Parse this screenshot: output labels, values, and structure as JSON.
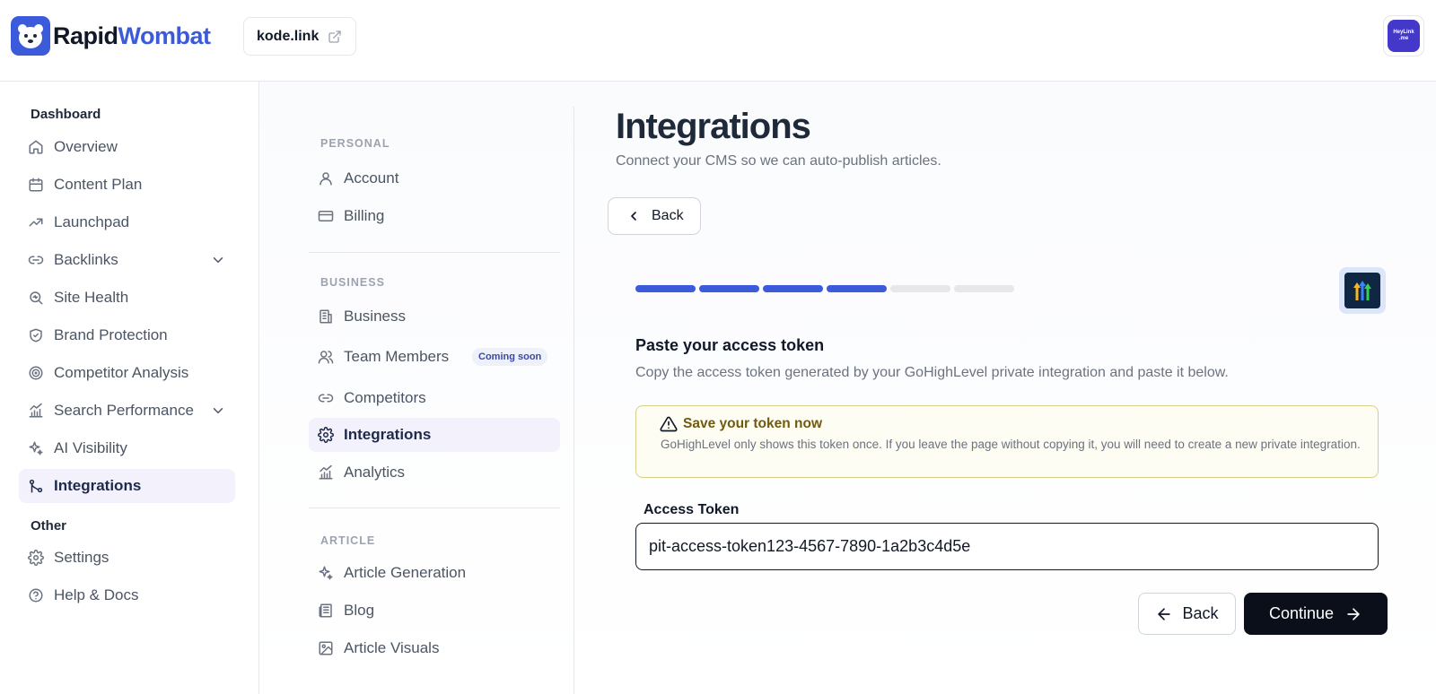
{
  "brand": {
    "name_part1": "Rapid",
    "name_part2": "Wombat",
    "color": "#3b5bdb"
  },
  "site_chip": {
    "label": "kode.link",
    "icon": "external-link-icon"
  },
  "avatar": {
    "text_line1": "HeyLink",
    "text_line2": ".me"
  },
  "sidebar": {
    "sections": [
      {
        "title": "Dashboard"
      },
      {
        "title": "Other"
      }
    ],
    "items": [
      {
        "label": "Overview",
        "icon": "home-icon"
      },
      {
        "label": "Content Plan",
        "icon": "calendar-icon"
      },
      {
        "label": "Launchpad",
        "icon": "trending-up-icon"
      },
      {
        "label": "Backlinks",
        "icon": "link-icon",
        "expandable": true
      },
      {
        "label": "Site Health",
        "icon": "search-health-icon"
      },
      {
        "label": "Brand Protection",
        "icon": "shield-check-icon"
      },
      {
        "label": "Competitor Analysis",
        "icon": "target-icon"
      },
      {
        "label": "Search Performance",
        "icon": "bar-chart-icon",
        "expandable": true
      },
      {
        "label": "AI Visibility",
        "icon": "sparkles-icon"
      },
      {
        "label": "Integrations",
        "icon": "git-merge-icon",
        "active": true
      },
      {
        "label": "Settings",
        "icon": "gear-icon"
      },
      {
        "label": "Help & Docs",
        "icon": "help-circle-icon"
      }
    ]
  },
  "settings_nav": {
    "groups": [
      {
        "title": "PERSONAL"
      },
      {
        "title": "BUSINESS"
      },
      {
        "title": "ARTICLE"
      }
    ],
    "items": [
      {
        "label": "Account",
        "icon": "user-icon"
      },
      {
        "label": "Billing",
        "icon": "credit-card-icon"
      },
      {
        "label": "Business",
        "icon": "building-icon"
      },
      {
        "label": "Team Members",
        "icon": "users-icon",
        "badge": "Coming soon"
      },
      {
        "label": "Competitors",
        "icon": "link-icon"
      },
      {
        "label": "Integrations",
        "icon": "gear-icon",
        "active": true
      },
      {
        "label": "Analytics",
        "icon": "bar-chart-icon"
      },
      {
        "label": "Article Generation",
        "icon": "sparkles-icon"
      },
      {
        "label": "Blog",
        "icon": "newspaper-icon"
      },
      {
        "label": "Article Visuals",
        "icon": "image-icon"
      }
    ]
  },
  "page": {
    "title": "Integrations",
    "subtitle": "Connect your CMS so we can auto-publish articles.",
    "back_label": "Back"
  },
  "wizard": {
    "total_steps": 6,
    "completed_steps": 4,
    "active_color": "#3b5bdb",
    "inactive_color": "#e5e7eb",
    "provider_icon": "gohighlevel-logo",
    "step_title": "Paste your access token",
    "step_description": "Copy the access token generated by your GoHighLevel private integration and paste it below.",
    "alert": {
      "title": "Save your token now",
      "body": "GoHighLevel only shows this token once. If you leave the page without copying it, you will need to create a new private integration.",
      "icon": "warning-triangle-icon"
    },
    "field": {
      "label": "Access Token",
      "value": "pit-access-token123-4567-7890-1a2b3c4d5e"
    },
    "buttons": {
      "back": "Back",
      "continue": "Continue"
    }
  }
}
